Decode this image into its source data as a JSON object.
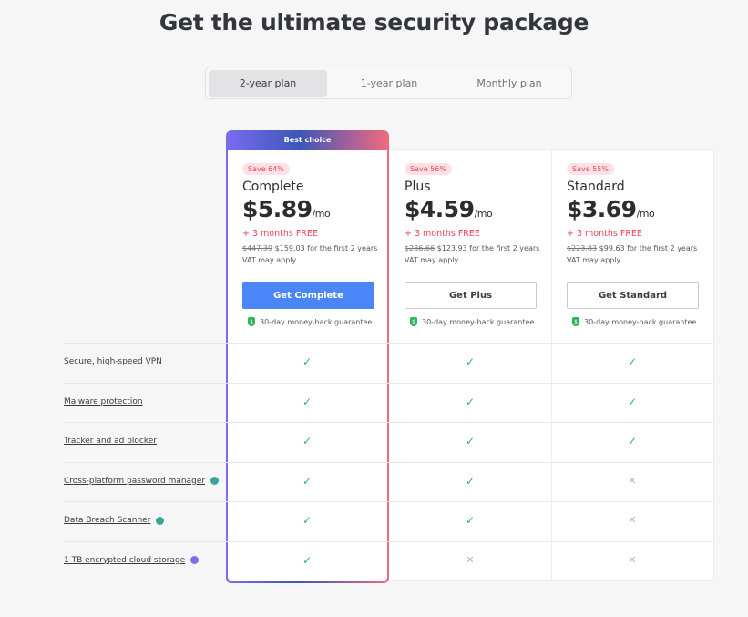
{
  "title": "Get the ultimate security package",
  "tabs": [
    {
      "label": "2-year plan",
      "active": true
    },
    {
      "label": "1-year plan"
    },
    {
      "label": "Monthly plan"
    }
  ],
  "best_choice": "Best choice",
  "plans": [
    {
      "save": "Save 64%",
      "name": "Complete",
      "price": "$5.89",
      "per": "/mo",
      "free": "+ 3 months FREE",
      "orig": "$447.39",
      "now": "$159.03 for the first 2 years",
      "vat": "VAT may apply",
      "button": "Get Complete",
      "guarantee": "30-day money-back guarantee"
    },
    {
      "save": "Save 56%",
      "name": "Plus",
      "price": "$4.59",
      "per": "/mo",
      "free": "+ 3 months FREE",
      "orig": "$286.66",
      "now": "$123.93 for the first 2 years",
      "vat": "VAT may apply",
      "button": "Get Plus",
      "guarantee": "30-day money-back guarantee"
    },
    {
      "save": "Save 55%",
      "name": "Standard",
      "price": "$3.69",
      "per": "/mo",
      "free": "+ 3 months FREE",
      "orig": "$223.83",
      "now": "$99.63 for the first 2 years",
      "vat": "VAT may apply",
      "button": "Get Standard",
      "guarantee": "30-day money-back guarantee"
    }
  ],
  "features": [
    {
      "label": "Secure, high-speed VPN",
      "icon": null,
      "included": [
        true,
        true,
        true
      ]
    },
    {
      "label": "Malware protection",
      "icon": null,
      "included": [
        true,
        true,
        true
      ]
    },
    {
      "label": "Tracker and ad blocker",
      "icon": null,
      "included": [
        true,
        true,
        true
      ]
    },
    {
      "label": "Cross-platform password manager",
      "icon": "#3aa39a",
      "included": [
        true,
        true,
        false
      ]
    },
    {
      "label": "Data Breach Scanner",
      "icon": "#3aa39a",
      "included": [
        true,
        true,
        false
      ]
    },
    {
      "label": "1 TB encrypted cloud storage",
      "icon": "#7b6cf0",
      "included": [
        true,
        false,
        false
      ]
    }
  ],
  "colors": {
    "primary": "#4a86f7",
    "accent": "#e8445a",
    "check": "#2fb55a"
  }
}
